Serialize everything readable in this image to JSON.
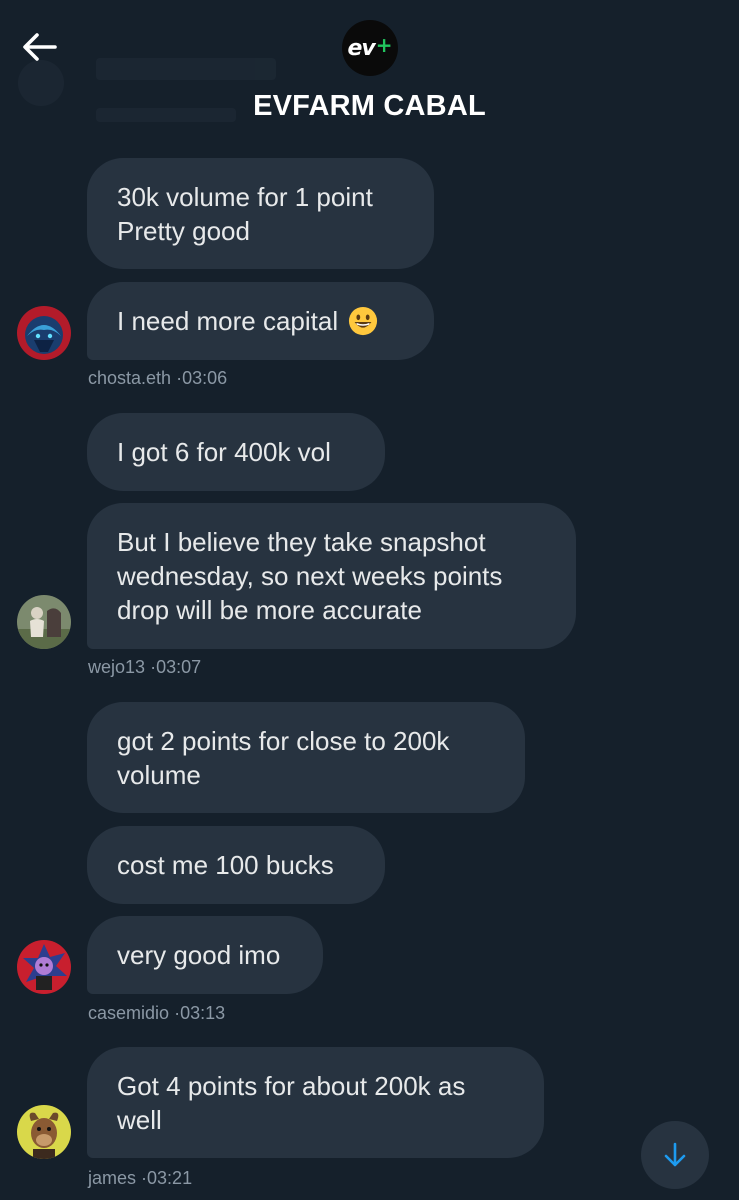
{
  "header": {
    "back_icon": "arrow-left-icon",
    "group_logo_text": "ev",
    "group_logo_plus": "+",
    "title": "EVFARM CABAL"
  },
  "messages": [
    {
      "text": "30k volume for 1 point\nPretty good"
    },
    {
      "text": "I need more capital",
      "emoji": "grinning-face-emoji"
    },
    {
      "text": "I got 6 for 400k vol"
    },
    {
      "text": "But I believe they take snapshot\nwednesday, so next weeks points\ndrop will be more accurate"
    },
    {
      "text": "got 2 points for close to 200k\nvolume"
    },
    {
      "text": "cost me 100 bucks"
    },
    {
      "text": "very good imo"
    },
    {
      "text": "Got 4 points for about 200k as\nwell"
    }
  ],
  "senders": [
    {
      "name": "chosta.eth",
      "time": "03:06"
    },
    {
      "name": "wejo13",
      "time": "03:07"
    },
    {
      "name": "casemidio",
      "time": "03:13"
    },
    {
      "name": "james",
      "time": "03:21"
    }
  ],
  "meta_separator": "·",
  "scroll_button_icon": "arrow-down-icon",
  "colors": {
    "background": "#15202b",
    "bubble": "#273340",
    "text": "#e7e9ea",
    "meta_text": "#8b98a5",
    "accent_blue": "#1d9bf0",
    "logo_green": "#22c55e"
  }
}
